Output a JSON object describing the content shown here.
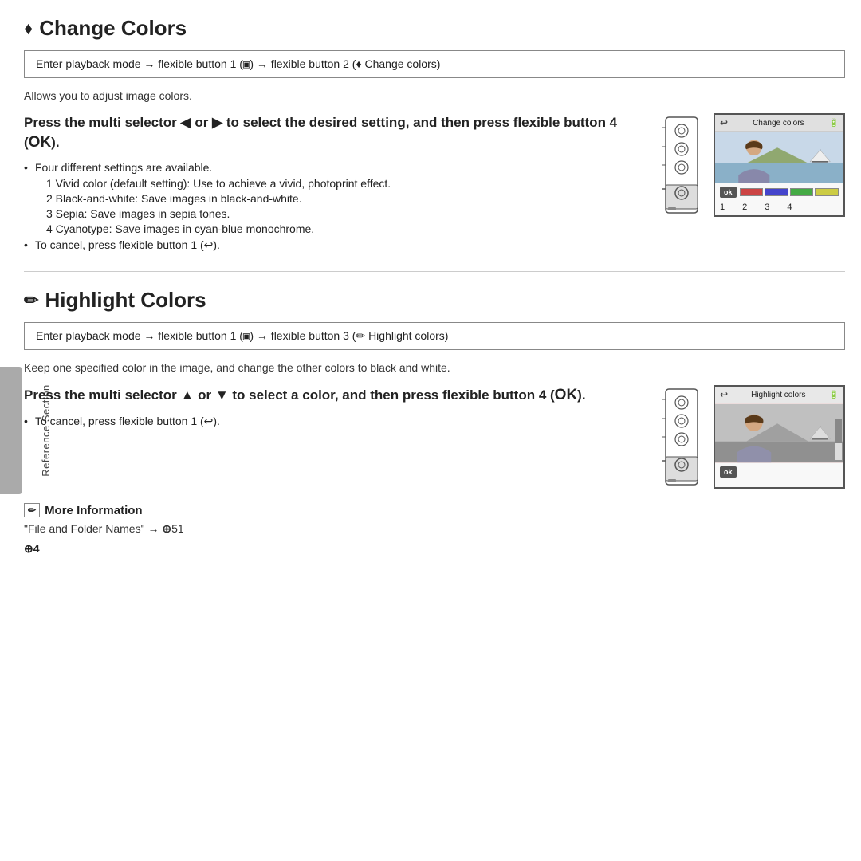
{
  "sidebar": {
    "label": "Reference Section"
  },
  "section1": {
    "icon": "♦",
    "title": "Change Colors",
    "nav_path": "Enter playback mode → flexible button 1 (▣) → flexible button 2 (♦ Change colors)",
    "description": "Allows you to adjust image colors.",
    "instruction": "Press the multi selector ◀ or ▶ to select the desired setting, and then press flexible button 4 (",
    "ok_label": "OK",
    "instruction_end": ").",
    "bullets": [
      "Four different settings are available."
    ],
    "sub_bullets": [
      "1  Vivid color (default setting): Use to achieve a vivid, photoprint effect.",
      "2  Black-and-white: Save images in black-and-white.",
      "3  Sepia: Save images in sepia tones.",
      "4  Cyanotype: Save images in cyan-blue monochrome."
    ],
    "cancel_bullet": "To cancel, press flexible button 1 (↩).",
    "screen_title": "Change colors",
    "screen_numbers": [
      "1",
      "2",
      "3",
      "4"
    ],
    "ok_button": "ok"
  },
  "section2": {
    "icon": "✏",
    "title": "Highlight Colors",
    "nav_path": "Enter playback mode → flexible button 1 (▣) → flexible button 3 (✏ Highlight colors)",
    "description": "Keep one specified color in the image, and change the other colors to black and white.",
    "instruction": "Press the multi selector ▲ or ▼ to select a color, and then press flexible button 4 (",
    "ok_label": "OK",
    "instruction_end": ").",
    "cancel_bullet": "To cancel, press flexible button 1 (↩).",
    "screen_title": "Highlight colors",
    "ok_button": "ok"
  },
  "more_info": {
    "icon": "✏",
    "title": "More Information",
    "text": "\"File and Folder Names\" → ⊕51"
  },
  "page_number": "⊕4"
}
